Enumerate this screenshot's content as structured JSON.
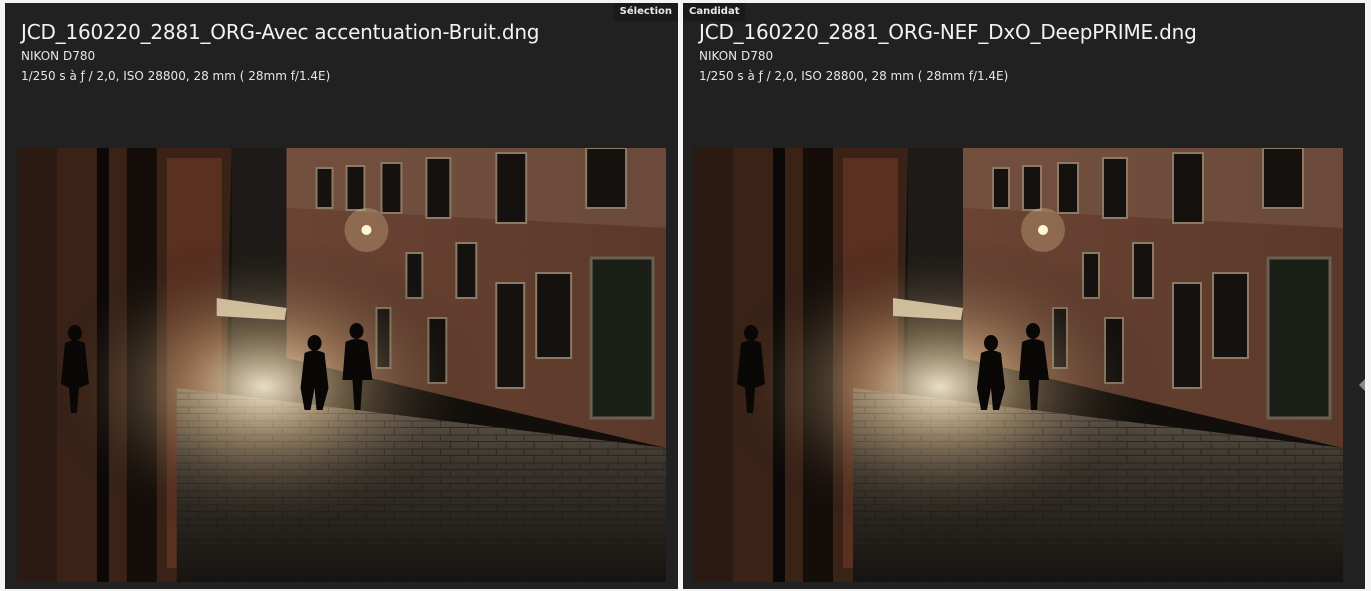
{
  "left_panel": {
    "tag": "Sélection",
    "filename": "JCD_160220_2881_ORG-Avec accentuation-Bruit.dng",
    "camera": "NIKON D780",
    "exposure": "1/250 s à ƒ / 2,0, ISO 28800, 28 mm ( 28mm f/1.4E)"
  },
  "right_panel": {
    "tag": "Candidat",
    "filename": "JCD_160220_2881_ORG-NEF_DxO_DeepPRIME.dng",
    "camera": "NIKON D780",
    "exposure": "1/250 s à ƒ / 2,0, ISO 28800, 28 mm ( 28mm f/1.4E)"
  },
  "colors": {
    "panel_background": "#212121",
    "text": "#f2f2f2",
    "page_background": "#f4f4f4"
  }
}
